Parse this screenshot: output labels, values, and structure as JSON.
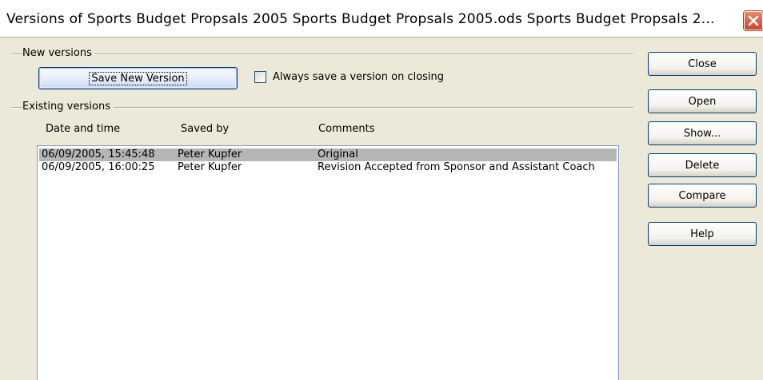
{
  "window": {
    "title": "Versions of Sports Budget Propsals 2005 Sports Budget Propsals 2005.ods Sports Budget Propsals 2..."
  },
  "new_versions": {
    "group_label": "New versions",
    "save_button_label": "Save New Version",
    "checkbox_label": "Always save a version on closing",
    "checkbox_checked": false
  },
  "existing_versions": {
    "group_label": "Existing versions",
    "columns": {
      "date": "Date and time",
      "saved_by": "Saved by",
      "comments": "Comments"
    },
    "rows": [
      {
        "date": "06/09/2005, 15:45:48",
        "saved_by": "Peter Kupfer",
        "comment": "Original",
        "selected": true
      },
      {
        "date": "06/09/2005, 16:00:25",
        "saved_by": "Peter Kupfer",
        "comment": "Revision Accepted from Sponsor and Assistant Coach",
        "selected": false
      }
    ]
  },
  "buttons": {
    "close": "Close",
    "open": "Open",
    "show": "Show...",
    "delete": "Delete",
    "compare": "Compare",
    "help": "Help"
  },
  "colors": {
    "dialog_bg": "#ece9d8",
    "selection": "#b5b5b5",
    "close_button": "#c8452a"
  }
}
